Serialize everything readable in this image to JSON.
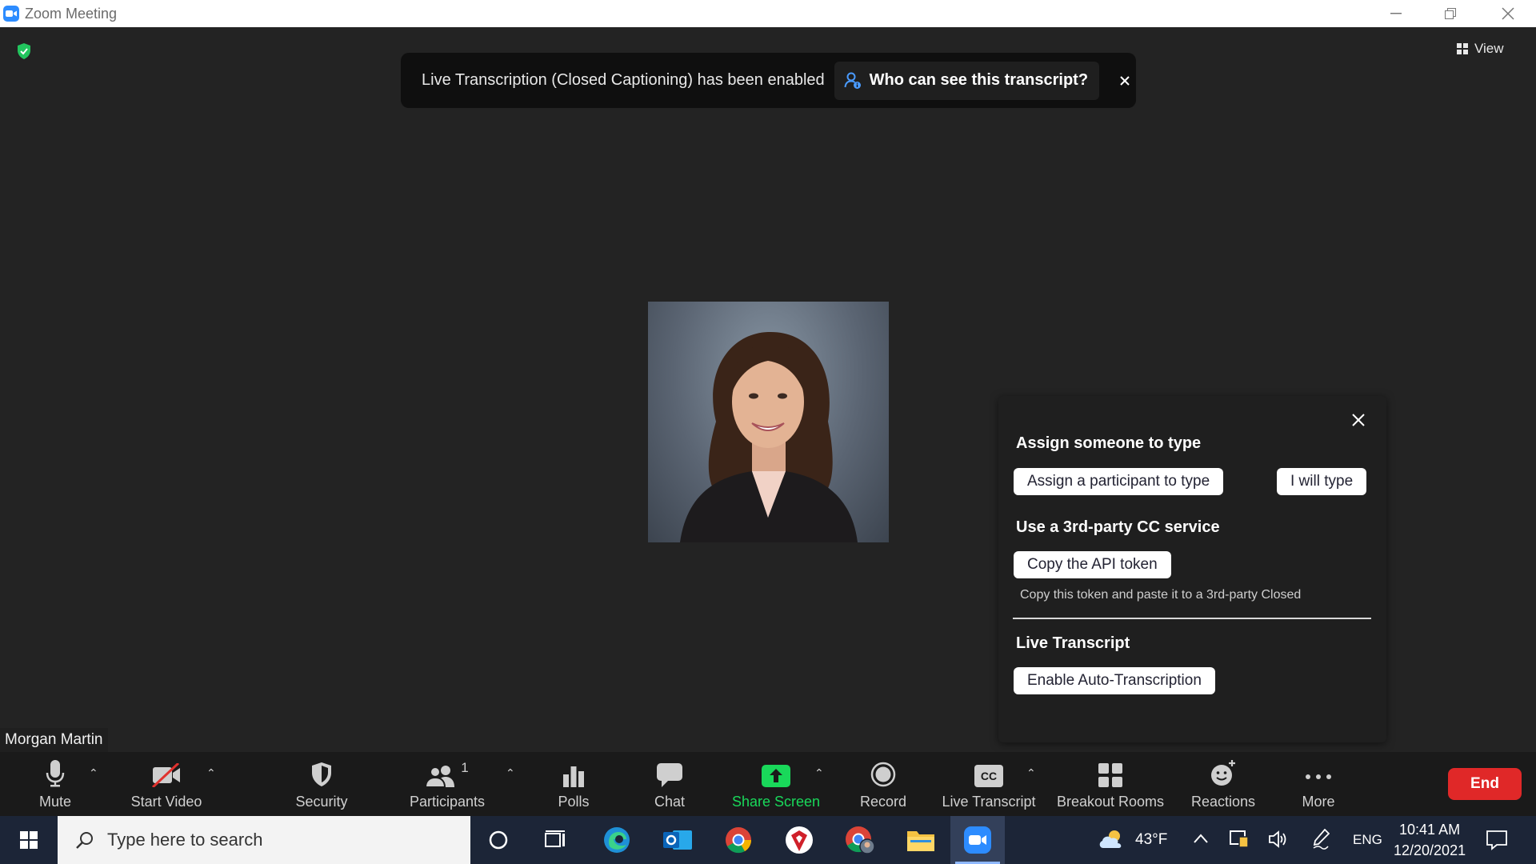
{
  "window": {
    "title": "Zoom Meeting"
  },
  "meeting": {
    "view_label": "View",
    "notification": {
      "message": "Live Transcription (Closed Captioning) has been enabled",
      "who_can_see": "Who can see this transcript?"
    },
    "participant_name": "Morgan Martin"
  },
  "cc_panel": {
    "assign_heading": "Assign someone to type",
    "assign_participant_button": "Assign a participant to type",
    "i_will_type_button": "I will type",
    "third_party_heading": "Use a 3rd-party CC service",
    "copy_token_button": "Copy the API token",
    "copy_token_hint": "Copy this token and paste it to a 3rd-party Closed",
    "live_transcript_heading": "Live Transcript",
    "enable_auto_button": "Enable Auto-Transcription"
  },
  "toolbar": {
    "mute": "Mute",
    "start_video": "Start Video",
    "security": "Security",
    "participants": "Participants",
    "participants_count": "1",
    "polls": "Polls",
    "chat": "Chat",
    "share_screen": "Share Screen",
    "record": "Record",
    "live_transcript": "Live Transcript",
    "cc_badge": "CC",
    "breakout_rooms": "Breakout Rooms",
    "reactions": "Reactions",
    "more": "More",
    "end": "End"
  },
  "taskbar": {
    "search_placeholder": "Type here to search",
    "weather_temp": "43°F",
    "language": "ENG",
    "time": "10:41 AM",
    "date": "12/20/2021"
  },
  "colors": {
    "accent_green": "#19d85a",
    "end_red": "#e02828",
    "zoom_blue": "#2d8cff",
    "security_shield": "#22c55e"
  }
}
